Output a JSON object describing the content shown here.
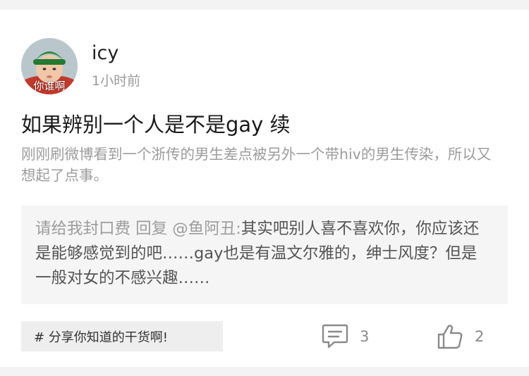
{
  "post": {
    "author": {
      "name": "icy",
      "avatar_caption": "你谁啊",
      "avatar_icon": "avatar-child-photo-icon"
    },
    "time_ago": "1小时前",
    "title": "如果辨别一个人是不是gay 续",
    "excerpt": "刚刚刷微博看到一个浙传的男生差点被另外一个带hiv的男生传染，所以又想起了点事。",
    "reply": {
      "prefix": "请给我封口费 回复 @鱼阿丑:",
      "text": "其实吧别人喜不喜欢你，你应该还是能够感觉到的吧……gay也是有温文尔雅的，绅士风度？但是一般对女的不感兴趣……"
    },
    "tag": "# 分享你知道的干货啊!",
    "comments": {
      "icon": "comment-icon",
      "count": "3"
    },
    "likes": {
      "icon": "thumbs-up-icon",
      "count": "2"
    }
  },
  "colors": {
    "background": "#ffffff",
    "divider_strip": "#f3f3f3",
    "title_text": "#1a1a1a",
    "muted_text": "#9c9c9c",
    "reply_background": "#f5f5f5",
    "tag_background": "#eeeeee",
    "icon_gray": "#8a8a8a"
  }
}
